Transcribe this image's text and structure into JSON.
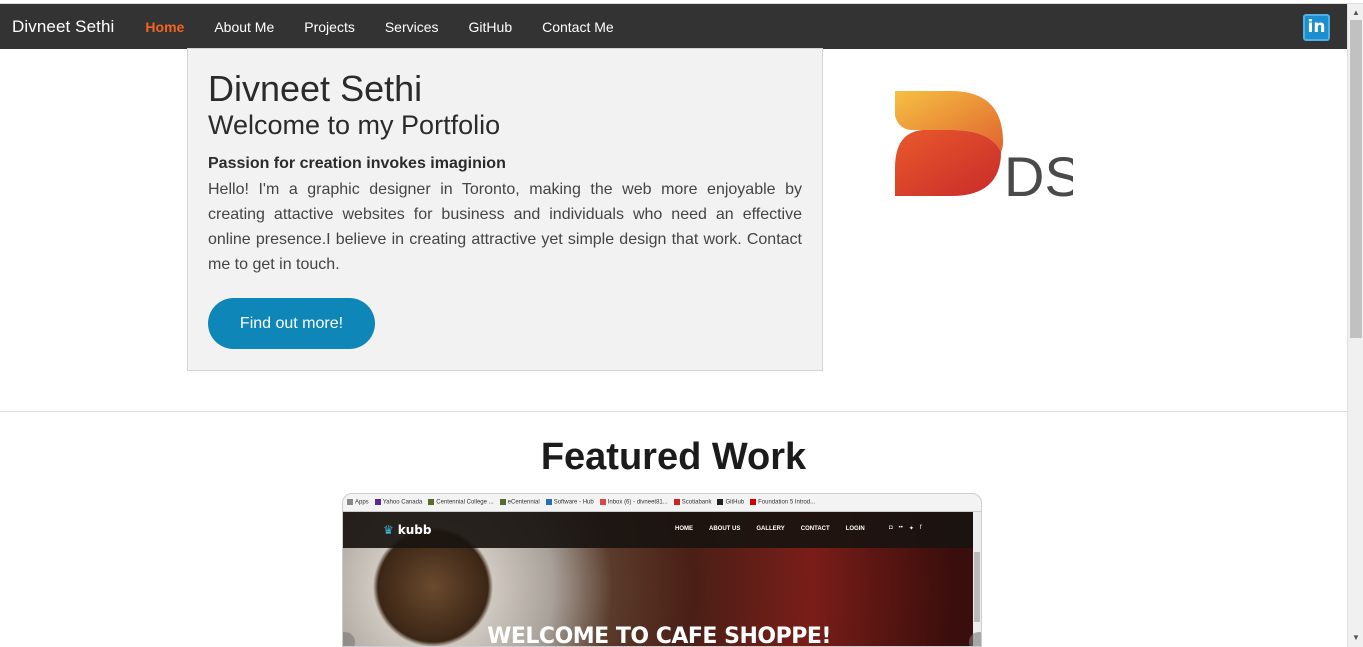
{
  "navbar": {
    "brand": "Divneet Sethi",
    "items": [
      {
        "label": "Home",
        "active": true
      },
      {
        "label": "About Me"
      },
      {
        "label": "Projects"
      },
      {
        "label": "Services"
      },
      {
        "label": "GitHub"
      },
      {
        "label": "Contact Me"
      }
    ],
    "linkedin_icon": "linkedin-icon",
    "linkedin_text": "in",
    "colors": {
      "background": "#333333",
      "active": "#f26522"
    }
  },
  "hero": {
    "title": "Divneet Sethi",
    "subtitle": "Welcome to my Portfolio",
    "tagline": "Passion for creation invokes imaginion",
    "body": "Hello! I'm a graphic designer in Toronto, making the web more enjoyable by creating attactive websites for business and individuals who need an effective online presence.I believe in creating attractive yet simple design that work. Contact me to get in touch.",
    "cta_label": "Find out more!",
    "cta_color": "#0e86b7"
  },
  "logo": {
    "text": "DS",
    "colors": {
      "top": "#f4b23c",
      "bottom": "#d62f2b",
      "text": "#4a4a4a"
    }
  },
  "featured": {
    "title": "Featured Work",
    "preview": {
      "bookmarks": [
        "Apps",
        "Yahoo Canada",
        "Centennial College ...",
        "eCentennial",
        "Software - Hub",
        "Inbox (6) - divneet81...",
        "Scotiabank",
        "GitHub",
        "Foundation 5 Introd..."
      ],
      "site_logo": "kubb",
      "site_nav": [
        "HOME",
        "ABOUT US",
        "GALLERY",
        "CONTACT",
        "LOGIN"
      ],
      "site_social": [
        "instagram-icon",
        "flickr-icon",
        "twitter-icon",
        "facebook-icon"
      ],
      "headline": "WELCOME TO CAFE SHOPPE!"
    }
  }
}
